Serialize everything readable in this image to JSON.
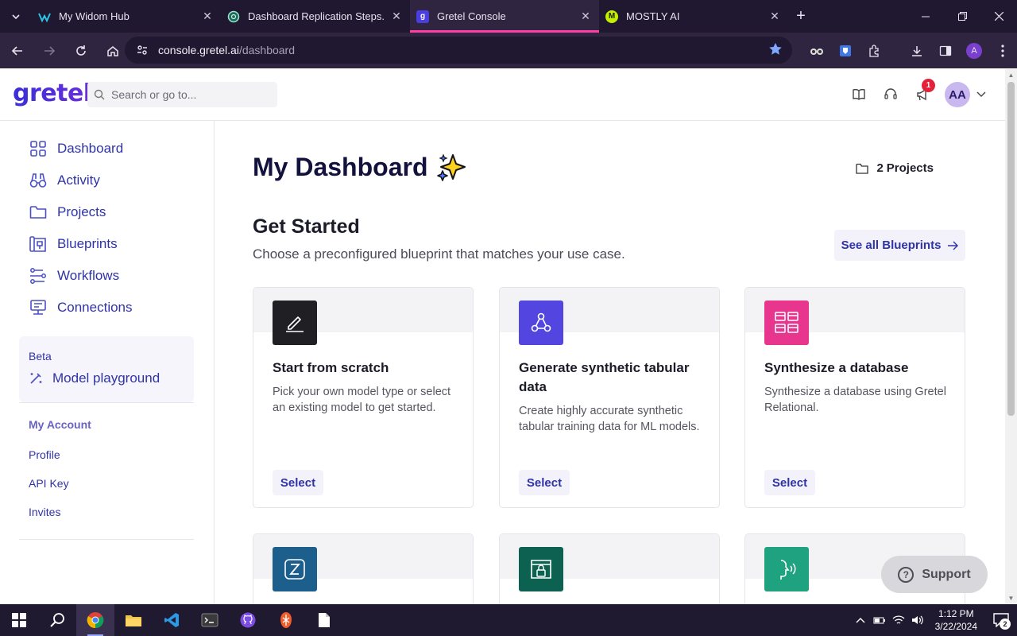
{
  "browser": {
    "tabs": [
      {
        "title": "My Widom Hub",
        "favicon": "widom-icon",
        "active": false
      },
      {
        "title": "Dashboard Replication Steps.",
        "favicon": "chatgpt-icon",
        "active": false
      },
      {
        "title": "Gretel Console",
        "favicon": "gretel-icon",
        "active": true
      },
      {
        "title": "MOSTLY AI",
        "favicon": "mostly-ai-icon",
        "active": false
      }
    ],
    "url_host": "console.gretel.ai",
    "url_path": "/dashboard",
    "profile_initial": "A",
    "mostly_initial": "M",
    "gretel_initial": "g"
  },
  "header": {
    "logo": "gretel",
    "search_placeholder": "Search or go to...",
    "notification_count": "1",
    "avatar_initials": "AA"
  },
  "sidebar": {
    "items": [
      {
        "label": "Dashboard",
        "icon": "grid-icon"
      },
      {
        "label": "Activity",
        "icon": "binoculars-icon"
      },
      {
        "label": "Projects",
        "icon": "folder-icon"
      },
      {
        "label": "Blueprints",
        "icon": "blueprint-icon"
      },
      {
        "label": "Workflows",
        "icon": "workflow-icon"
      },
      {
        "label": "Connections",
        "icon": "connections-icon"
      }
    ],
    "beta_label": "Beta",
    "playground_label": "Model playground",
    "account_title": "My Account",
    "account_links": [
      "Profile",
      "API Key",
      "Invites"
    ]
  },
  "main": {
    "title": "My Dashboard",
    "projects_count": "2",
    "projects_label": "Projects",
    "section_title": "Get Started",
    "section_subtitle": "Choose a preconfigured blueprint that matches your use case.",
    "see_all_label": "See all Blueprints",
    "cards": [
      {
        "title": "Start from scratch",
        "description": "Pick your own model type or select an existing model to get started.",
        "button": "Select",
        "icon": "pen-icon",
        "color": "#1f1f24"
      },
      {
        "title": "Generate synthetic tabular data",
        "description": "Create highly accurate synthetic tabular training data for ML models.",
        "button": "Select",
        "icon": "nodes-icon",
        "color": "#5346e0"
      },
      {
        "title": "Synthesize a database",
        "description": "Synthesize a database using Gretel Relational.",
        "button": "Select",
        "icon": "tables-icon",
        "color": "#e8368f"
      }
    ],
    "cards_row2_icons": [
      {
        "icon": "z-icon",
        "color": "#1d5f8c"
      },
      {
        "icon": "lock-window-icon",
        "color": "#0d6151"
      },
      {
        "icon": "speech-icon",
        "color": "#1fa27f"
      }
    ],
    "support_label": "Support"
  },
  "taskbar": {
    "time": "1:12 PM",
    "date": "3/22/2024",
    "notifications": "2"
  },
  "colors": {
    "accent": "#2f33a8",
    "tab_highlight": "#ff3fa4",
    "chrome_bg": "#1f1830"
  }
}
